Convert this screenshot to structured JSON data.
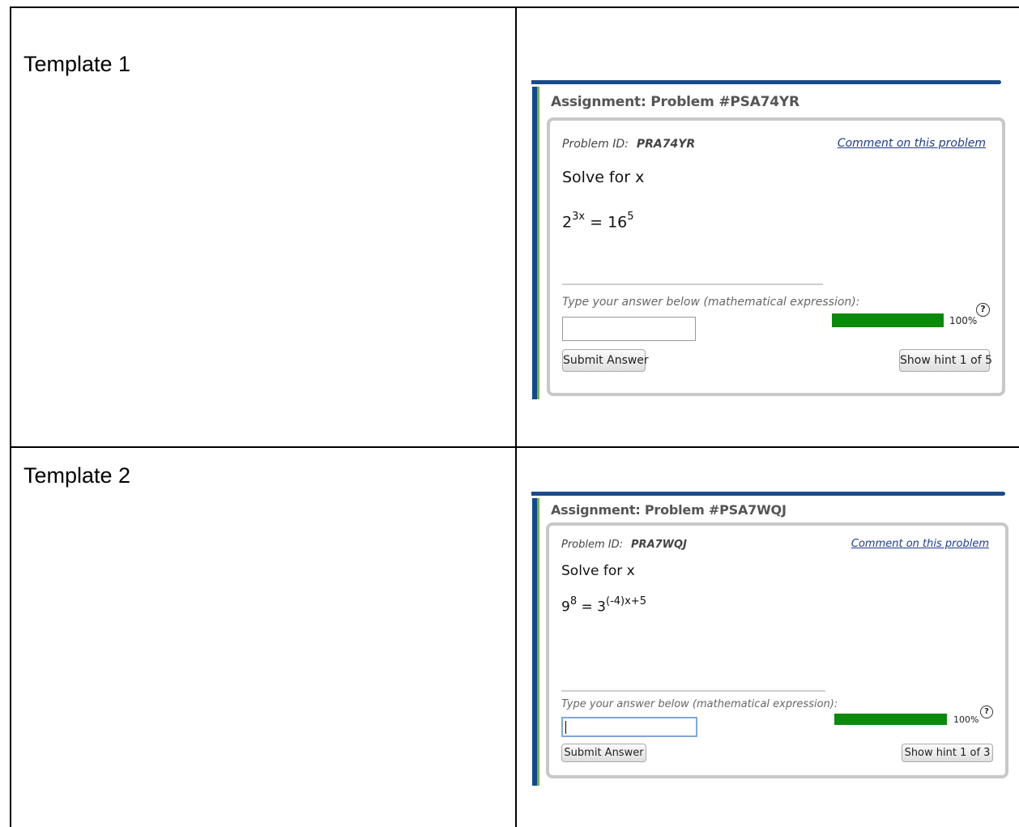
{
  "templates": [
    {
      "title": "Template 1",
      "assignment": "Assignment: Problem #PSA74YR",
      "problem_id_label": "Problem ID:",
      "problem_id": "PRA74YR",
      "comment_link": "Comment on this problem",
      "instruction": "Solve for x",
      "equation": {
        "lhs_base": "2",
        "lhs_exp": "3x",
        "op": " = ",
        "rhs_base": "16",
        "rhs_exp": "5"
      },
      "prompt": "Type your answer below (mathematical expression):",
      "answer_value": "",
      "submit_label": "Submit Answer",
      "hint_label": "Show hint 1 of 5",
      "progress_percent": 100,
      "progress_label": "100%",
      "help_symbol": "?"
    },
    {
      "title": "Template 2",
      "assignment": "Assignment: Problem #PSA7WQJ",
      "problem_id_label": "Problem ID:",
      "problem_id": "PRA7WQJ",
      "comment_link": "Comment on this problem",
      "instruction": "Solve for x",
      "equation": {
        "lhs_base": "9",
        "lhs_exp": "8",
        "op": " = ",
        "rhs_base": "3",
        "rhs_exp": "(-4)x+5"
      },
      "prompt": "Type your answer below (mathematical expression):",
      "answer_value": "",
      "submit_label": "Submit Answer",
      "hint_label": "Show hint 1 of 3",
      "progress_percent": 100,
      "progress_label": "100%",
      "help_symbol": "?"
    }
  ],
  "colors": {
    "progress_fill": "#0b8a0b",
    "header_bar": "#1a4a8a",
    "link": "#1e3d8f",
    "accent_green": "#7ab33e"
  }
}
